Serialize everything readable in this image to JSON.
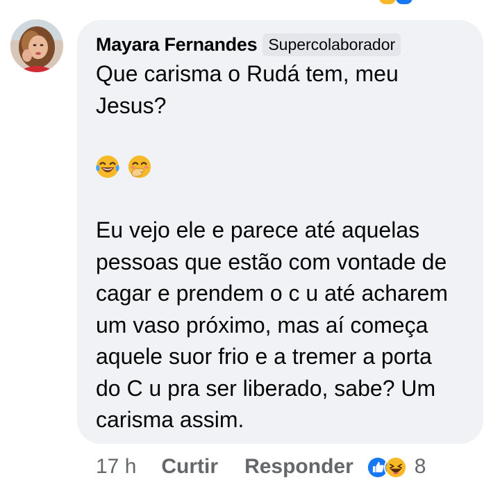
{
  "comment": {
    "author": "Mayara Fernandes",
    "badge": "Supercolaborador",
    "paragraph1": "Que carisma o Rudá tem, meu\nJesus?",
    "emojis": [
      "face-with-tears-of-joy-icon",
      "face-with-hand-over-mouth-icon"
    ],
    "paragraph2": "Eu vejo ele e parece até aquelas\npessoas que estão com vontade de\ncagar e prendem o c u até acharem\num vaso próximo, mas aí começa\naquele suor frio e a tremer a porta\ndo C u pra ser liberado, sabe? Um\ncarisma assim."
  },
  "meta": {
    "time": "17 h",
    "like_label": "Curtir",
    "reply_label": "Responder",
    "reaction_icons": [
      "like-reaction-icon",
      "haha-reaction-icon"
    ],
    "reaction_count": "8"
  },
  "colors": {
    "bubble": "#f0f2f5",
    "badge": "#e4e6eb",
    "text": "#050505",
    "secondary_text": "#65676b",
    "like_blue": "#1877f2",
    "haha_yellow": "#f7b928"
  }
}
